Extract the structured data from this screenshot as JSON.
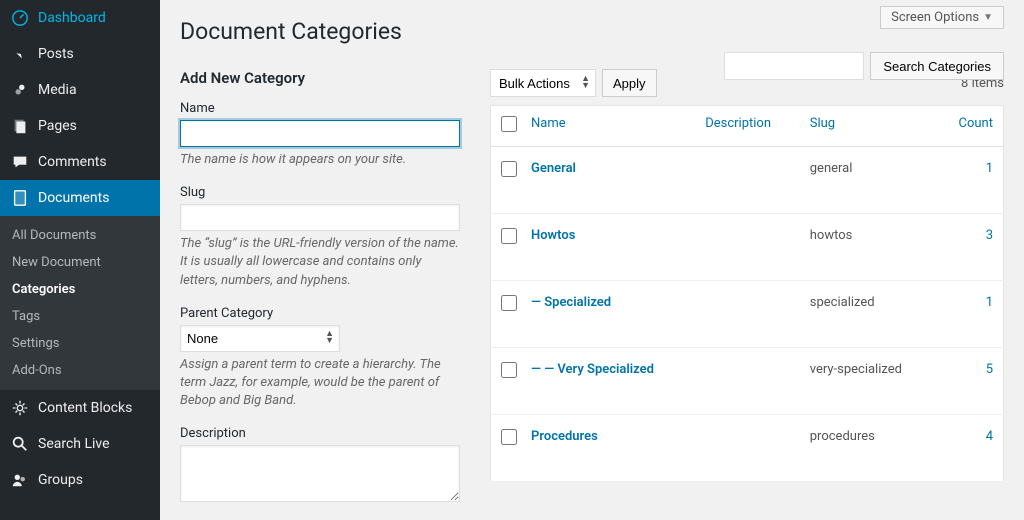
{
  "sidebar": {
    "main_items": [
      {
        "label": "Dashboard",
        "icon": "dashboard"
      },
      {
        "label": "Posts",
        "icon": "pin"
      },
      {
        "label": "Media",
        "icon": "media"
      },
      {
        "label": "Pages",
        "icon": "pages"
      },
      {
        "label": "Comments",
        "icon": "comment"
      }
    ],
    "current": {
      "label": "Documents",
      "icon": "document"
    },
    "submenu": [
      {
        "label": "All Documents",
        "active": false
      },
      {
        "label": "New Document",
        "active": false
      },
      {
        "label": "Categories",
        "active": true
      },
      {
        "label": "Tags",
        "active": false
      },
      {
        "label": "Settings",
        "active": false
      },
      {
        "label": "Add-Ons",
        "active": false
      }
    ],
    "bottom_items": [
      {
        "label": "Content Blocks",
        "icon": "gear"
      },
      {
        "label": "Search Live",
        "icon": "search"
      },
      {
        "label": "Groups",
        "icon": "groups"
      }
    ]
  },
  "screen_options": "Screen Options",
  "page_title": "Document Categories",
  "search": {
    "button": "Search Categories"
  },
  "form": {
    "heading": "Add New Category",
    "name_label": "Name",
    "name_desc": "The name is how it appears on your site.",
    "slug_label": "Slug",
    "slug_desc": "The “slug” is the URL-friendly version of the name. It is usually all lowercase and contains only letters, numbers, and hyphens.",
    "parent_label": "Parent Category",
    "parent_value": "None",
    "parent_desc": "Assign a parent term to create a hierarchy. The term Jazz, for example, would be the parent of Bebop and Big Band.",
    "description_label": "Description"
  },
  "bulk": {
    "label": "Bulk Actions",
    "apply": "Apply"
  },
  "items_count": "8 items",
  "columns": {
    "name": "Name",
    "description": "Description",
    "slug": "Slug",
    "count": "Count"
  },
  "rows": [
    {
      "name": "General",
      "description": "",
      "slug": "general",
      "count": "1"
    },
    {
      "name": "Howtos",
      "description": "",
      "slug": "howtos",
      "count": "3"
    },
    {
      "name": "— Specialized",
      "description": "",
      "slug": "specialized",
      "count": "1"
    },
    {
      "name": "— — Very Specialized",
      "description": "",
      "slug": "very-specialized",
      "count": "5"
    },
    {
      "name": "Procedures",
      "description": "",
      "slug": "procedures",
      "count": "4"
    }
  ]
}
